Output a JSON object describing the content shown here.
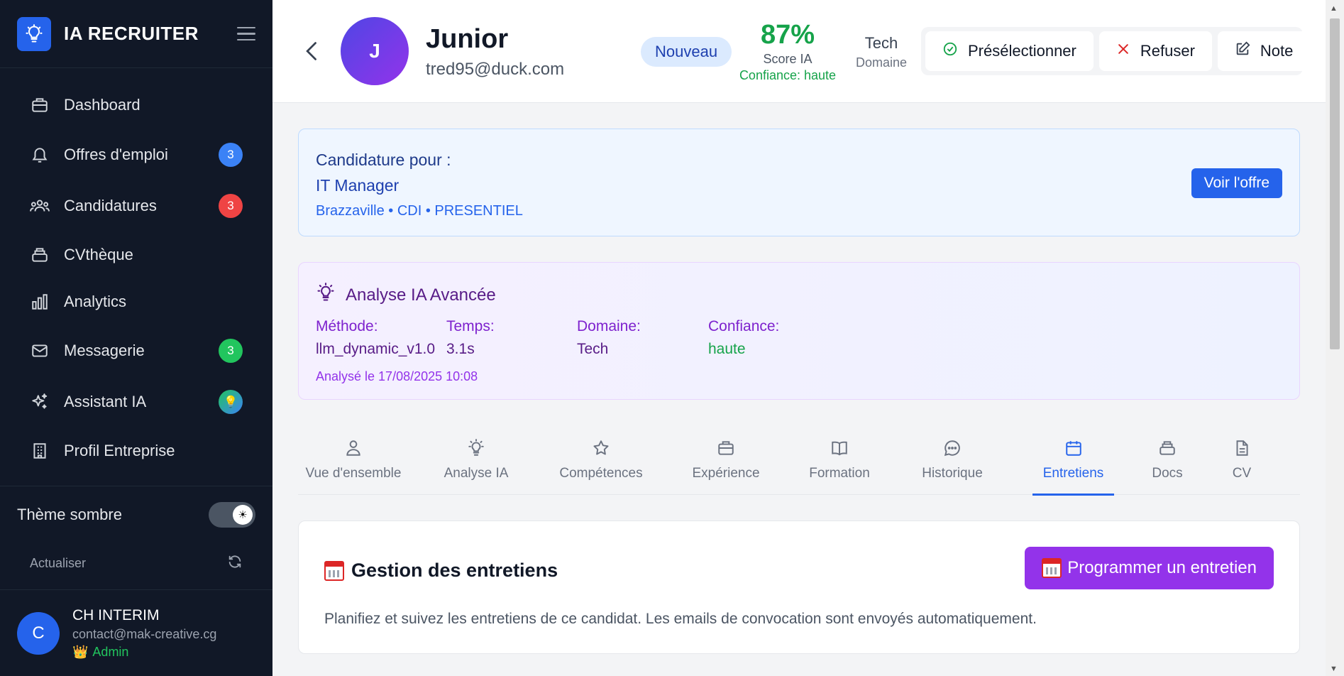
{
  "app": {
    "name": "IA RECRUITER"
  },
  "sidebar": {
    "items": [
      {
        "label": "Dashboard",
        "icon": "briefcase-icon",
        "badge": ""
      },
      {
        "label": "Offres d'emploi",
        "icon": "bell-icon",
        "badge": "3",
        "badge_color": "#3b82f6"
      },
      {
        "label": "Candidatures",
        "icon": "users-icon",
        "badge": "3",
        "badge_color": "#ef4444"
      },
      {
        "label": "CVthèque",
        "icon": "archive-icon",
        "badge": ""
      },
      {
        "label": "Analytics",
        "icon": "bar-chart-icon",
        "badge": ""
      },
      {
        "label": "Messagerie",
        "icon": "mail-icon",
        "badge": "3",
        "badge_color": "#22c55e"
      },
      {
        "label": "Assistant IA",
        "icon": "sparkles-icon",
        "badge": "💡"
      },
      {
        "label": "Profil Entreprise",
        "icon": "building-icon",
        "badge": ""
      }
    ],
    "theme_label": "Thème sombre",
    "refresh_label": "Actualiser",
    "user": {
      "initial": "C",
      "name": "CH INTERIM",
      "email": "contact@mak-creative.cg",
      "role": "Admin"
    }
  },
  "candidate": {
    "initial": "J",
    "name": "Junior",
    "email": "tred95@duck.com",
    "status": "Nouveau",
    "score": "87%",
    "score_label": "Score IA",
    "confidence": "Confiance: haute",
    "domain": "Tech",
    "domain_label": "Domaine"
  },
  "actions": {
    "shortlist": "Présélectionner",
    "reject": "Refuser",
    "note": "Note"
  },
  "application": {
    "title": "Candidature pour :",
    "job": "IT Manager",
    "meta": "Brazzaville • CDI • PRESENTIEL",
    "view_offer": "Voir l'offre"
  },
  "ai_analysis": {
    "title": "Analyse IA Avancée",
    "method_label": "Méthode:",
    "method": "llm_dynamic_v1.0",
    "time_label": "Temps:",
    "time": "3.1s",
    "domain_label": "Domaine:",
    "domain": "Tech",
    "confidence_label": "Confiance:",
    "confidence": "haute",
    "analyzed": "Analysé le 17/08/2025 10:08"
  },
  "tabs": [
    {
      "label": "Vue d'ensemble",
      "icon": "user-icon"
    },
    {
      "label": "Analyse IA",
      "icon": "lightbulb-icon"
    },
    {
      "label": "Compétences",
      "icon": "star-icon"
    },
    {
      "label": "Expérience",
      "icon": "briefcase-icon"
    },
    {
      "label": "Formation",
      "icon": "book-icon"
    },
    {
      "label": "Historique",
      "icon": "chat-icon"
    },
    {
      "label": "Entretiens",
      "icon": "calendar-icon",
      "active": true
    },
    {
      "label": "Docs",
      "icon": "archive-icon"
    },
    {
      "label": "CV",
      "icon": "document-icon"
    }
  ],
  "interviews": {
    "title": "Gestion des entretiens",
    "schedule_button": "Programmer un entretien",
    "description": "Planifiez et suivez les entretiens de ce candidat. Les emails de convocation sont envoyés automatiquement."
  },
  "colors": {
    "sidebar_bg": "#111827",
    "primary": "#2563eb",
    "purple": "#9333ea",
    "green": "#16a34a"
  }
}
